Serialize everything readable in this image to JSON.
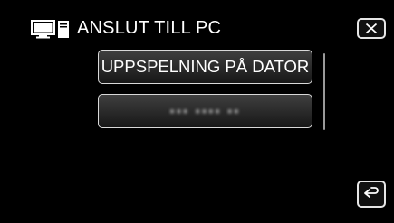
{
  "header": {
    "title": "ANSLUT TILL PC",
    "icon": "computer-icon"
  },
  "controls": {
    "close_icon": "close-icon",
    "back_icon": "return-arrow-icon"
  },
  "menu": {
    "items": [
      {
        "label": "UPPSPELNING PÅ DATOR",
        "state": "enabled"
      },
      {
        "label": "▪▪▪ ▪▪▪▪ ▪▪",
        "state": "disabled-blurred"
      }
    ]
  }
}
